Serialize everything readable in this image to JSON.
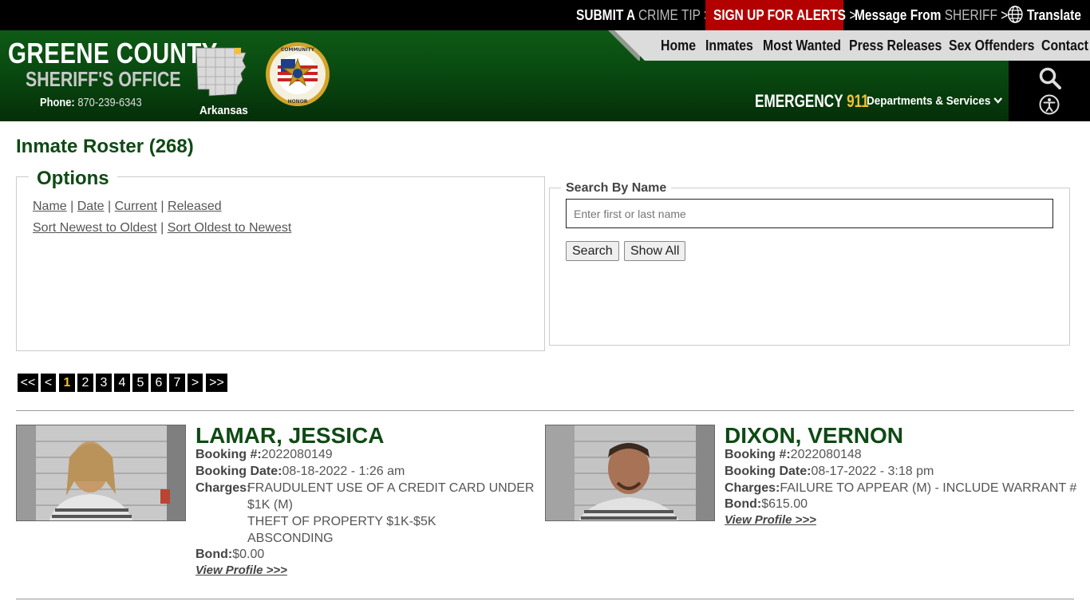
{
  "topbar": {
    "crime_tip_a": "SUBMIT A",
    "crime_tip_b": "CRIME TIP",
    "alerts": "SIGN UP FOR ALERTS",
    "message_a": "Message From",
    "message_b": "SHERIFF",
    "translate": "Translate",
    "chevron": ">"
  },
  "header": {
    "county": "GREENE COUNTY",
    "office": "SHERIFF'S OFFICE",
    "phone_label": "Phone:",
    "phone": "870-239-6343",
    "state": "Arkansas",
    "badge_top": "COMMUNITY",
    "badge_right": "INTEGRITY",
    "badge_bottom": "HONOR",
    "emergency_label": "EMERGENCY",
    "emergency_num": "911",
    "departments": "Departments & Services",
    "colors": {
      "green": "#0e5a16",
      "gold": "#f2c230",
      "alert_red": "#b30000"
    }
  },
  "nav": {
    "items": [
      "Home",
      "Inmates",
      "Most Wanted",
      "Press Releases",
      "Sex Offenders",
      "Contact"
    ]
  },
  "page": {
    "title": "Inmate Roster (268)"
  },
  "options": {
    "legend": "Options",
    "sort_fields": [
      "Name",
      "Date",
      "Current",
      "Released"
    ],
    "sort_orders": [
      "Sort Newest to Oldest",
      "Sort Oldest to Newest"
    ],
    "separator": "|"
  },
  "search": {
    "legend": "Search By Name",
    "placeholder": "Enter first or last name",
    "search_button": "Search",
    "show_all_button": "Show All"
  },
  "pager": {
    "first": "<<",
    "prev": "<",
    "pages": [
      "1",
      "2",
      "3",
      "4",
      "5",
      "6",
      "7"
    ],
    "next": ">",
    "last": ">>",
    "current": "1"
  },
  "inmates": [
    {
      "name": "LAMAR, JESSICA",
      "booking_label": "Booking #:",
      "booking": "2022080149",
      "date_label": "Booking Date:",
      "date": "08-18-2022 - 1:26 am",
      "charges_label": "Charges:",
      "charges": [
        "FRAUDULENT USE OF A CREDIT CARD UNDER $1K (M)",
        "THEFT OF PROPERTY $1K-$5K",
        "ABSCONDING"
      ],
      "bond_label": "Bond:",
      "bond": "$0.00",
      "profile_link": "View Profile >>>"
    },
    {
      "name": "DIXON, VERNON",
      "booking_label": "Booking #:",
      "booking": "2022080148",
      "date_label": "Booking Date:",
      "date": "08-17-2022 - 3:18 pm",
      "charges_label": "Charges:",
      "charges": [
        "FAILURE TO APPEAR (M) - INCLUDE WARRANT #"
      ],
      "bond_label": "Bond:",
      "bond": "$615.00",
      "profile_link": "View Profile >>>"
    }
  ]
}
